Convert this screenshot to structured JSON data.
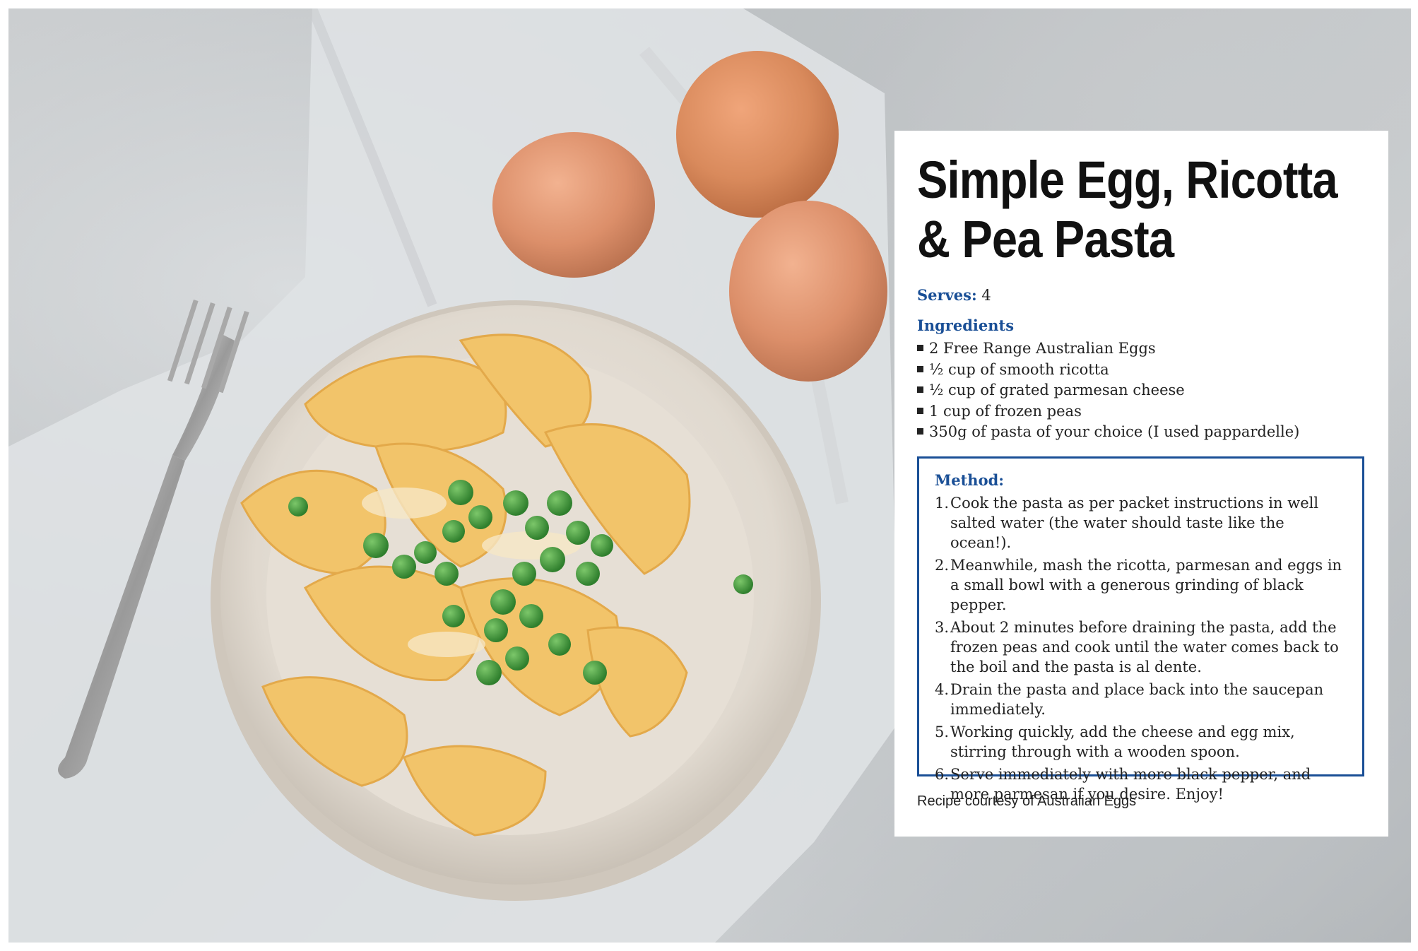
{
  "recipe": {
    "title_line1": "Simple Egg, Ricotta",
    "title_line2": "& Pea Pasta",
    "serves_label": "Serves:",
    "serves_value": "4",
    "ingredients_label": "Ingredients",
    "ingredients": [
      "2 Free Range Australian Eggs",
      "½ cup of smooth ricotta",
      "½ cup of grated parmesan cheese",
      "1 cup of frozen peas",
      "350g of pasta of your choice (I used pappardelle)"
    ],
    "method_label": "Method:",
    "steps": [
      {
        "num": "1.",
        "text": "Cook the pasta as per packet instructions in well salted water (the water should taste like the ocean!)."
      },
      {
        "num": "2.",
        "text": "Meanwhile, mash the ricotta, parmesan and eggs in a small bowl with a generous grinding of black pepper."
      },
      {
        "num": "3.",
        "text": "About 2 minutes before draining the pasta, add the frozen peas and cook until the water comes back to the boil and the pasta is al dente."
      },
      {
        "num": "4.",
        "text": "Drain the pasta and place back into the saucepan immediately."
      },
      {
        "num": "5.",
        "text": "Working quickly, add the cheese and egg mix, stirring through with a wooden spoon."
      },
      {
        "num": "6.",
        "text": "Serve immediately with more black pepper, and more parmesan if you desire. Enjoy!"
      }
    ],
    "credit": "Recipe courtesy of Australian Eggs"
  },
  "colors": {
    "accent_blue": "#1a4f96",
    "card_background": "#ffffff",
    "countertop": "#c2c6c9",
    "pasta": "#f2c46a",
    "pea": "#3f9a3a",
    "egg": "#d98a5c"
  }
}
